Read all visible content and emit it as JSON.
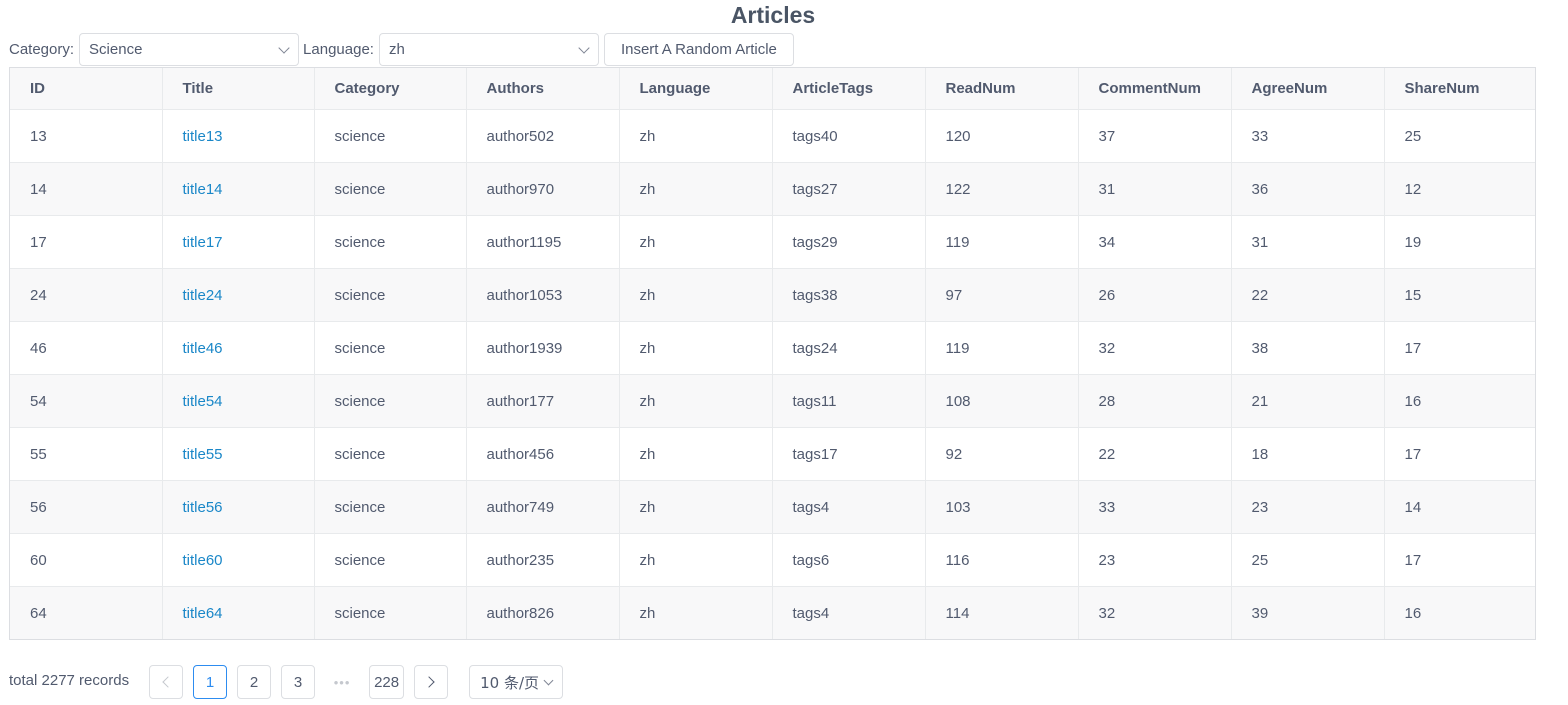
{
  "page": {
    "title": "Articles"
  },
  "filters": {
    "category_label": "Category:",
    "category_value": "Science",
    "language_label": "Language:",
    "language_value": "zh",
    "insert_button": "Insert A Random Article"
  },
  "table": {
    "columns": [
      "ID",
      "Title",
      "Category",
      "Authors",
      "Language",
      "ArticleTags",
      "ReadNum",
      "CommentNum",
      "AgreeNum",
      "ShareNum"
    ],
    "rows": [
      [
        "13",
        "title13",
        "science",
        "author502",
        "zh",
        "tags40",
        "120",
        "37",
        "33",
        "25"
      ],
      [
        "14",
        "title14",
        "science",
        "author970",
        "zh",
        "tags27",
        "122",
        "31",
        "36",
        "12"
      ],
      [
        "17",
        "title17",
        "science",
        "author1195",
        "zh",
        "tags29",
        "119",
        "34",
        "31",
        "19"
      ],
      [
        "24",
        "title24",
        "science",
        "author1053",
        "zh",
        "tags38",
        "97",
        "26",
        "22",
        "15"
      ],
      [
        "46",
        "title46",
        "science",
        "author1939",
        "zh",
        "tags24",
        "119",
        "32",
        "38",
        "17"
      ],
      [
        "54",
        "title54",
        "science",
        "author177",
        "zh",
        "tags11",
        "108",
        "28",
        "21",
        "16"
      ],
      [
        "55",
        "title55",
        "science",
        "author456",
        "zh",
        "tags17",
        "92",
        "22",
        "18",
        "17"
      ],
      [
        "56",
        "title56",
        "science",
        "author749",
        "zh",
        "tags4",
        "103",
        "33",
        "23",
        "14"
      ],
      [
        "60",
        "title60",
        "science",
        "author235",
        "zh",
        "tags6",
        "116",
        "23",
        "25",
        "17"
      ],
      [
        "64",
        "title64",
        "science",
        "author826",
        "zh",
        "tags4",
        "114",
        "32",
        "39",
        "16"
      ]
    ]
  },
  "pagination": {
    "total_text": "total 2277 records",
    "pages": [
      "1",
      "2",
      "3"
    ],
    "ellipsis": "•••",
    "last_page": "228",
    "current_page": "1",
    "page_size_label": "10 条/页"
  },
  "icons": {
    "category_dropdown": "chevron-down-icon",
    "language_dropdown": "chevron-down-icon",
    "prev": "chevron-left-icon",
    "next": "chevron-right-icon",
    "page_size_dropdown": "chevron-down-icon"
  },
  "colors": {
    "link": "#1a87c8",
    "active_page": "#2d8cf0",
    "header_bg": "#f8f8f9",
    "border": "#dcdee2"
  }
}
